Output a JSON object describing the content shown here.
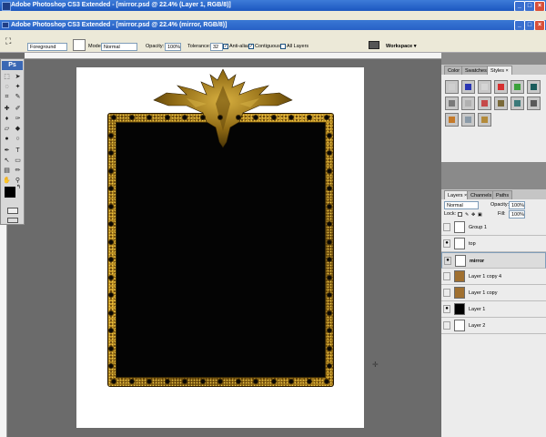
{
  "app": {
    "title": "Adobe Photoshop CS3 Extended - [mirror.psd @ 22.4% (Layer 1, RGB/8)]"
  },
  "document": {
    "title": "Adobe Photoshop CS3 Extended - [mirror.psd @ 22.4% (mirror, RGB/8)]"
  },
  "window_buttons": {
    "minimize": "_",
    "maximize": "□",
    "close": "×"
  },
  "options_bar": {
    "fill_source": "Foreground",
    "mode_label": "Mode:",
    "mode_value": "Normal",
    "opacity_label": "Opacity:",
    "opacity_value": "100%",
    "tolerance_label": "Tolerance:",
    "tolerance_value": "32",
    "antialias_label": "Anti-alias",
    "antialias_checked": true,
    "contiguous_label": "Contiguous",
    "contiguous_checked": true,
    "all_layers_label": "All Layers",
    "all_layers_checked": false,
    "workspace_label": "Workspace ▾"
  },
  "toolbox": {
    "logo": "Ps"
  },
  "panels": {
    "styles_tabs": [
      "Color",
      "Swatches",
      "Styles ×"
    ],
    "layers_tabs": [
      "Layers ×",
      "Channels",
      "Paths"
    ],
    "styles_colors": [
      "#cfcfcf",
      "#2a36b3",
      "#d5d5d5",
      "#d63030",
      "#3aa13a",
      "#1a5c5c",
      "#7a7a7a",
      "#b0b0b0",
      "#c54848",
      "#7a6a3a",
      "#3a7a7a",
      "#5a5a5a",
      "#c57a2a",
      "#8a9aa8",
      "#b38a3a"
    ]
  },
  "layers_panel": {
    "blend_mode": "Normal",
    "opacity_label": "Opacity:",
    "opacity_value": "100%",
    "lock_label": "Lock:",
    "fill_label": "Fill:",
    "fill_value": "100%",
    "layers": [
      {
        "name": "Group 1",
        "visible": false,
        "selected": false
      },
      {
        "name": "top",
        "visible": true,
        "selected": false
      },
      {
        "name": "mirror",
        "visible": true,
        "selected": true
      },
      {
        "name": "Layer 1 copy 4",
        "visible": false,
        "selected": false
      },
      {
        "name": "Layer 1 copy",
        "visible": false,
        "selected": false
      },
      {
        "name": "Layer 1",
        "visible": true,
        "selected": false
      },
      {
        "name": "Layer 2",
        "visible": false,
        "selected": false
      }
    ]
  }
}
